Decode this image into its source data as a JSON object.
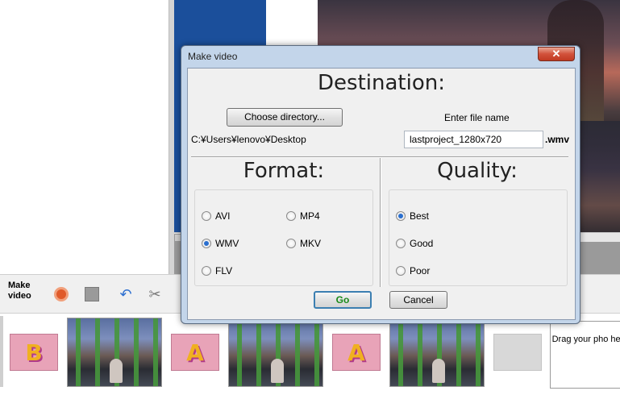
{
  "app": {
    "toolbar": {
      "make_video_label": "Make video",
      "icons": [
        "record-icon",
        "page-icon",
        "undo-icon",
        "scissors-icon"
      ]
    },
    "filmstrip": {
      "items": [
        {
          "type": "letter",
          "letter": "B"
        },
        {
          "type": "photo"
        },
        {
          "type": "letter",
          "letter": "A"
        },
        {
          "type": "photo"
        },
        {
          "type": "letter",
          "letter": "A"
        },
        {
          "type": "photo"
        },
        {
          "type": "blank"
        }
      ],
      "drop_zone_text": "Drag your pho here"
    }
  },
  "dialog": {
    "title": "Make video",
    "close_symbol": "✕",
    "destination": {
      "heading": "Destination:",
      "choose_button": "Choose directory...",
      "enter_file_label": "Enter file name",
      "path": "C:¥Users¥lenovo¥Desktop",
      "file_name": "lastproject_1280x720",
      "extension": ".wmv"
    },
    "format": {
      "heading": "Format:",
      "options": [
        {
          "label": "AVI",
          "checked": false
        },
        {
          "label": "MP4",
          "checked": false
        },
        {
          "label": "WMV",
          "checked": true
        },
        {
          "label": "MKV",
          "checked": false
        },
        {
          "label": "FLV",
          "checked": false
        }
      ]
    },
    "quality": {
      "heading": "Quality:",
      "options": [
        {
          "label": "Best",
          "checked": true
        },
        {
          "label": "Good",
          "checked": false
        },
        {
          "label": "Poor",
          "checked": false
        }
      ]
    },
    "buttons": {
      "go": "Go",
      "cancel": "Cancel"
    }
  }
}
